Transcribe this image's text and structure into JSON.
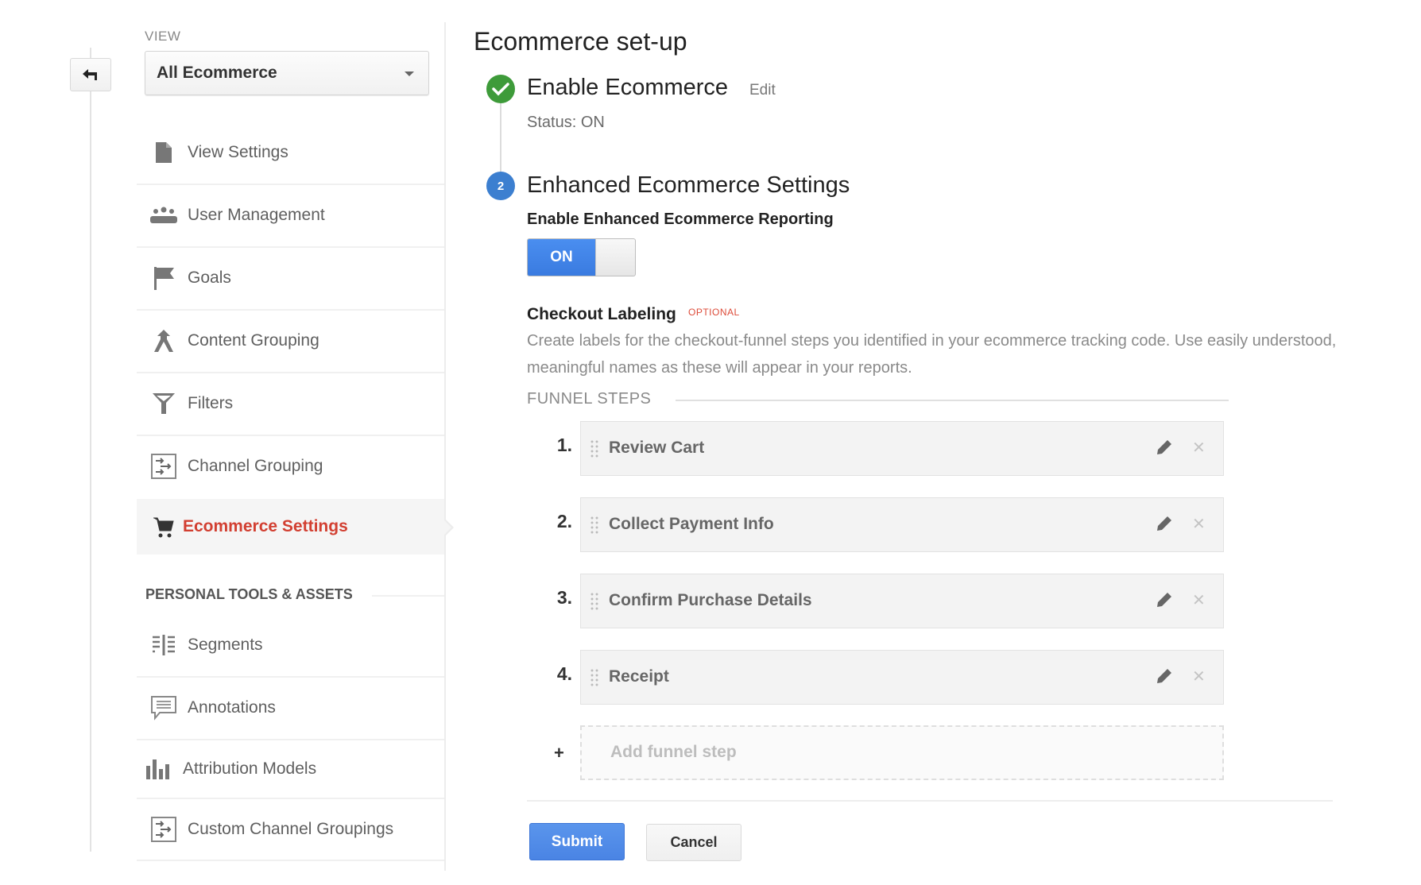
{
  "sidebar": {
    "back_icon": "back-arrow-icon",
    "view_label": "VIEW",
    "view_select": "All Ecommerce",
    "items": [
      {
        "label": "View Settings",
        "icon": "document-icon"
      },
      {
        "label": "User Management",
        "icon": "users-icon"
      },
      {
        "label": "Goals",
        "icon": "flag-icon"
      },
      {
        "label": "Content Grouping",
        "icon": "merge-icon"
      },
      {
        "label": "Filters",
        "icon": "filter-icon"
      },
      {
        "label": "Channel Grouping",
        "icon": "channel-grouping-icon"
      },
      {
        "label": "Ecommerce Settings",
        "icon": "cart-icon",
        "active": true
      }
    ],
    "section_header": "PERSONAL TOOLS & ASSETS",
    "personal_items": [
      {
        "label": "Segments",
        "icon": "segments-icon"
      },
      {
        "label": "Annotations",
        "icon": "annotation-icon"
      },
      {
        "label": "Attribution Models",
        "icon": "bar-chart-icon"
      },
      {
        "label": "Custom Channel Groupings",
        "icon": "channel-grouping-icon"
      }
    ]
  },
  "main": {
    "title": "Ecommerce set-up",
    "step1": {
      "number_icon": "check-icon",
      "title": "Enable Ecommerce",
      "edit_label": "Edit",
      "status": "Status: ON"
    },
    "step2": {
      "number": "2",
      "title": "Enhanced Ecommerce Settings"
    },
    "enable_reporting_label": "Enable Enhanced Ecommerce Reporting",
    "toggle": {
      "label": "ON",
      "state": "on"
    },
    "checkout_label": "Checkout Labeling",
    "optional_badge": "OPTIONAL",
    "description": "Create labels for the checkout-funnel steps you identified in your ecommerce tracking code. Use easily understood, meaningful names as these will appear in your reports.",
    "funnel_label": "FUNNEL STEPS",
    "funnel_steps": [
      {
        "number": "1.",
        "name": "Review Cart"
      },
      {
        "number": "2.",
        "name": "Collect Payment Info"
      },
      {
        "number": "3.",
        "name": "Confirm Purchase Details"
      },
      {
        "number": "4.",
        "name": "Receipt"
      }
    ],
    "add_plus": "+",
    "add_placeholder": "Add funnel step",
    "submit_label": "Submit",
    "cancel_label": "Cancel",
    "colors": {
      "accent_blue": "#4a84e4",
      "success_green": "#3e9b3a",
      "active_red": "#d23f31",
      "optional_red": "#dd4b39"
    }
  }
}
